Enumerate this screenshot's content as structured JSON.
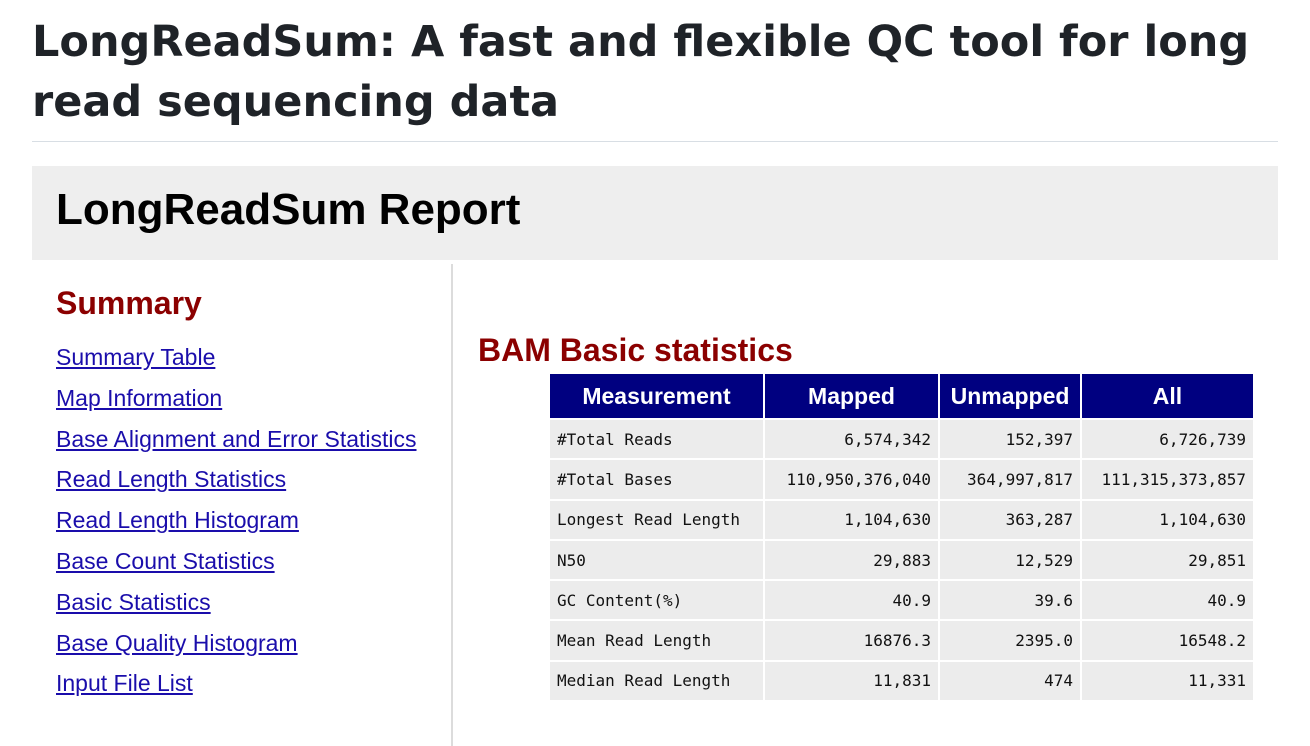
{
  "page": {
    "title": "LongReadSum: A fast and flexible QC tool for long read sequencing data"
  },
  "report": {
    "title": "LongReadSum Report"
  },
  "sidebar": {
    "heading": "Summary",
    "items": [
      {
        "label": "Summary Table"
      },
      {
        "label": "Map Information"
      },
      {
        "label": "Base Alignment and Error Statistics"
      },
      {
        "label": "Read Length Statistics"
      },
      {
        "label": "Read Length Histogram"
      },
      {
        "label": "Base Count Statistics"
      },
      {
        "label": "Basic Statistics"
      },
      {
        "label": "Base Quality Histogram"
      },
      {
        "label": "Input File List"
      }
    ]
  },
  "main": {
    "section_title": "BAM Basic statistics",
    "table": {
      "headers": [
        "Measurement",
        "Mapped",
        "Unmapped",
        "All"
      ],
      "rows": [
        [
          "#Total Reads",
          "6,574,342",
          "152,397",
          "6,726,739"
        ],
        [
          "#Total Bases",
          "110,950,376,040",
          "364,997,817",
          "111,315,373,857"
        ],
        [
          "Longest Read Length",
          "1,104,630",
          "363,287",
          "1,104,630"
        ],
        [
          "N50",
          "29,883",
          "12,529",
          "29,851"
        ],
        [
          "GC Content(%)",
          "40.9",
          "39.6",
          "40.9"
        ],
        [
          "Mean Read Length",
          "16876.3",
          "2395.0",
          "16548.2"
        ],
        [
          "Median Read Length",
          "11,831",
          "474",
          "11,331"
        ]
      ]
    }
  },
  "colors": {
    "header_bg": "#000080",
    "heading_color": "#8b0000",
    "link_color": "#1a0dab",
    "cell_bg": "#ececec",
    "report_header_bg": "#eeeeee"
  }
}
